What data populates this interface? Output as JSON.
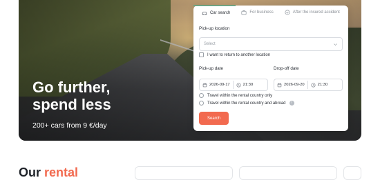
{
  "hero": {
    "title": "Go further, spend less",
    "subtitle": "200+ cars from 9 €/day"
  },
  "booking": {
    "tabs": [
      {
        "label": "Car search",
        "icon": "car-icon",
        "active": true
      },
      {
        "label": "For business",
        "icon": "briefcase-icon",
        "active": false
      },
      {
        "label": "After the insured accident",
        "icon": "check-circle-icon",
        "active": false
      }
    ],
    "pickup_location_label": "Pick-up location",
    "pickup_location_placeholder": "Select",
    "return_other_location_label": "I want to return to another location",
    "pickup_date_label": "Pick-up date",
    "pickup_date": "2026-09-17",
    "pickup_time": "21:30",
    "dropoff_date_label": "Drop-off date",
    "dropoff_date": "2026-09-20",
    "dropoff_time": "21:30",
    "travel_options": [
      "Travel within the rental country only",
      "Travel within the rental country and abroad"
    ],
    "info_glyph": "i",
    "search_label": "Search"
  },
  "section": {
    "heading_part1": "Our ",
    "heading_part2": "rental"
  },
  "colors": {
    "accent": "#f26a4f",
    "tab_active": "#25b59a"
  }
}
